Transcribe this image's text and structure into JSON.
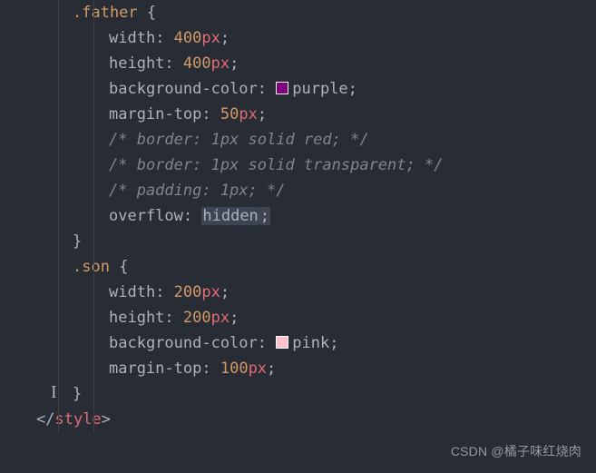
{
  "code": {
    "sel_father": ".father",
    "sel_son": ".son",
    "brace_open": " {",
    "brace_close": "}",
    "close_style_open": "</",
    "close_style_name": "style",
    "close_style_end": ">",
    "father": {
      "width_prop": "width",
      "width_num": "400",
      "width_unit": "px",
      "height_prop": "height",
      "height_num": "400",
      "height_unit": "px",
      "bg_prop": "background-color",
      "bg_val": "purple",
      "mtop_prop": "margin-top",
      "mtop_num": "50",
      "mtop_unit": "px",
      "cmt1": "/* border: 1px solid red; */",
      "cmt2": "/* border: 1px solid transparent; */",
      "cmt3": "/* padding: 1px; */",
      "overflow_prop": "overflow",
      "overflow_val": "hidden"
    },
    "son": {
      "width_prop": "width",
      "width_num": "200",
      "width_unit": "px",
      "height_prop": "height",
      "height_num": "200",
      "height_unit": "px",
      "bg_prop": "background-color",
      "bg_val": "pink",
      "mtop_prop": "margin-top",
      "mtop_num": "100",
      "mtop_unit": "px"
    },
    "colon": ": ",
    "semi": ";"
  },
  "colors": {
    "purple": "#800080",
    "pink": "#ffc0cb"
  },
  "watermark": "CSDN @橘子味红烧肉",
  "chart_data": {
    "type": "table",
    "title": "CSS rules",
    "rules": [
      {
        "selector": ".father",
        "declarations": [
          {
            "property": "width",
            "value": "400px"
          },
          {
            "property": "height",
            "value": "400px"
          },
          {
            "property": "background-color",
            "value": "purple"
          },
          {
            "property": "margin-top",
            "value": "50px"
          },
          {
            "property": "border",
            "value": "1px solid red",
            "commented": true
          },
          {
            "property": "border",
            "value": "1px solid transparent",
            "commented": true
          },
          {
            "property": "padding",
            "value": "1px",
            "commented": true
          },
          {
            "property": "overflow",
            "value": "hidden"
          }
        ]
      },
      {
        "selector": ".son",
        "declarations": [
          {
            "property": "width",
            "value": "200px"
          },
          {
            "property": "height",
            "value": "200px"
          },
          {
            "property": "background-color",
            "value": "pink"
          },
          {
            "property": "margin-top",
            "value": "100px"
          }
        ]
      }
    ]
  }
}
